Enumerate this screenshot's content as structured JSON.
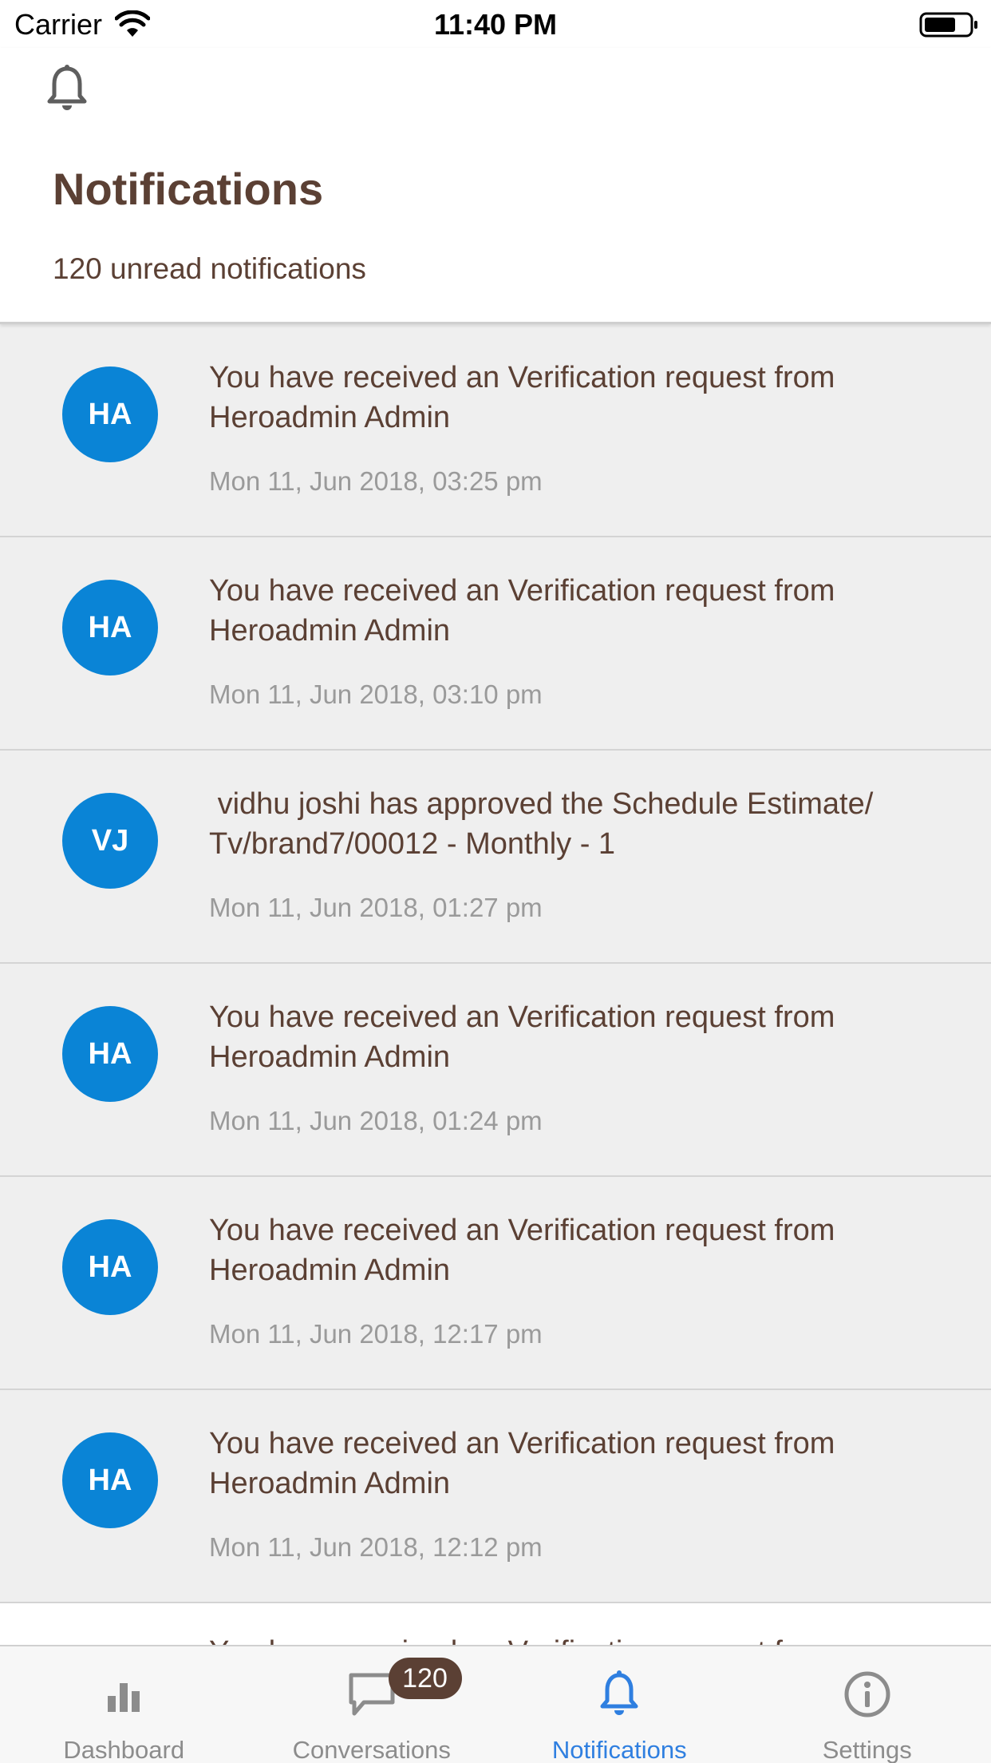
{
  "status_bar": {
    "carrier": "Carrier",
    "time": "11:40 PM"
  },
  "header": {
    "icon": "bell-icon",
    "title": "Notifications",
    "unread_text": "120 unread notifications"
  },
  "notifications": [
    {
      "initials": "HA",
      "text": "You have received an Verification request from Heroadmin Admin",
      "time": "Mon 11, Jun 2018, 03:25 pm"
    },
    {
      "initials": "HA",
      "text": "You have received an Verification request from Heroadmin Admin",
      "time": "Mon 11, Jun 2018, 03:10 pm"
    },
    {
      "initials": "VJ",
      "text": " vidhu joshi has approved the Schedule Estimate/ Tv/brand7/00012 - Monthly - 1",
      "time": "Mon 11, Jun 2018, 01:27 pm"
    },
    {
      "initials": "HA",
      "text": "You have received an Verification request from Heroadmin Admin",
      "time": "Mon 11, Jun 2018, 01:24 pm"
    },
    {
      "initials": "HA",
      "text": "You have received an Verification request from Heroadmin Admin",
      "time": "Mon 11, Jun 2018, 12:17 pm"
    },
    {
      "initials": "HA",
      "text": "You have received an Verification request from Heroadmin Admin",
      "time": "Mon 11, Jun 2018, 12:12 pm"
    }
  ],
  "partial_notification": {
    "text": "You have received an Verification request from"
  },
  "tabs": [
    {
      "label": "Dashboard",
      "icon": "bar-chart-icon"
    },
    {
      "label": "Conversations",
      "icon": "chat-bubble-icon",
      "badge": "120"
    },
    {
      "label": "Notifications",
      "icon": "bell-icon",
      "active": true
    },
    {
      "label": "Settings",
      "icon": "info-icon"
    }
  ],
  "colors": {
    "accent": "#2f7fe0",
    "avatar": "#0a84d6",
    "text_brown": "#5b4034",
    "row_background": "#efefef"
  }
}
